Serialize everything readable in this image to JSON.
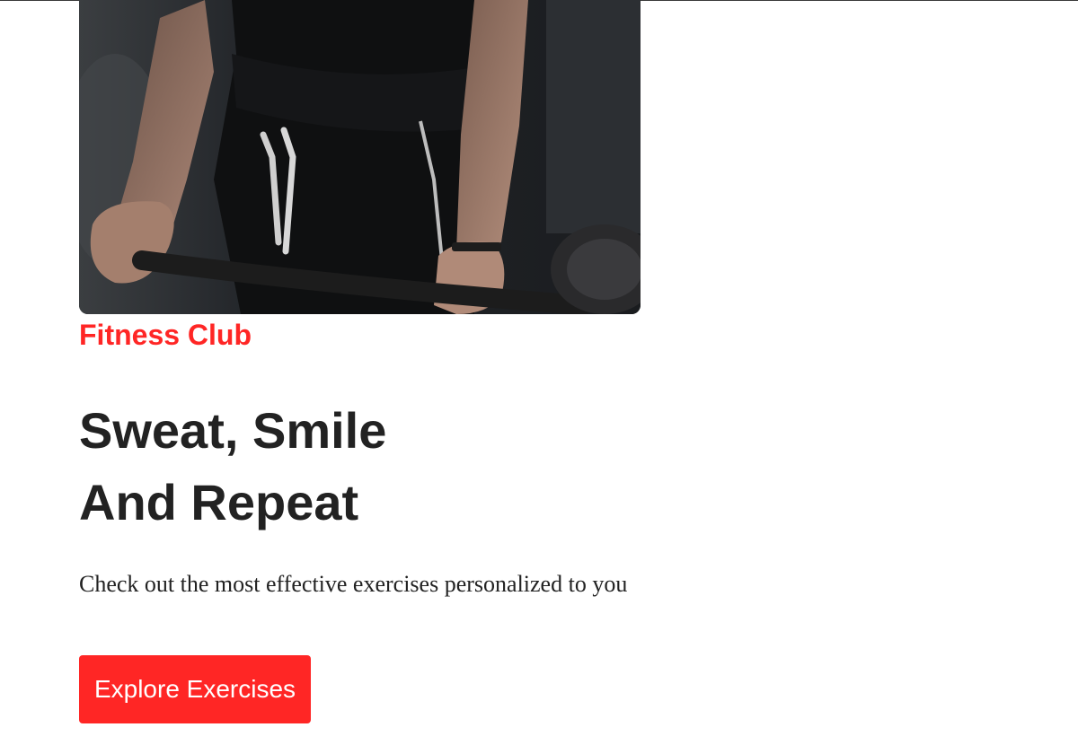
{
  "hero": {
    "brand": "Fitness Club",
    "headline_line1": "Sweat, Smile",
    "headline_line2": "And Repeat",
    "subtext": "Check out the most effective exercises personalized to you",
    "cta_label": "Explore Exercises"
  },
  "colors": {
    "accent": "#ff2625",
    "text": "#222222",
    "background": "#ffffff"
  }
}
